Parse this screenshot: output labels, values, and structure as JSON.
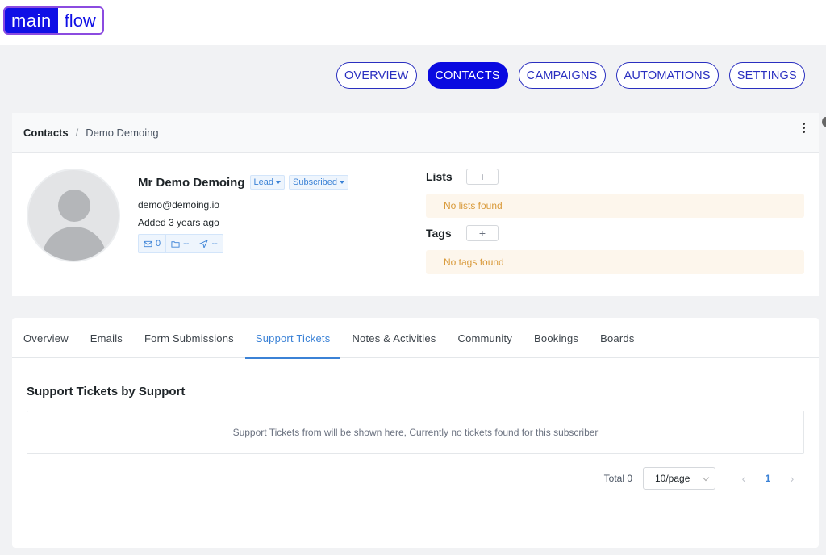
{
  "brand": {
    "part1": "main",
    "part2": "flow"
  },
  "nav": [
    {
      "label": "OVERVIEW",
      "active": false
    },
    {
      "label": "CONTACTS",
      "active": true
    },
    {
      "label": "CAMPAIGNS",
      "active": false
    },
    {
      "label": "AUTOMATIONS",
      "active": false
    },
    {
      "label": "SETTINGS",
      "active": false
    }
  ],
  "breadcrumb": {
    "root": "Contacts",
    "separator": "/",
    "current": "Demo Demoing"
  },
  "profile": {
    "name": "Mr Demo Demoing",
    "status": "Lead",
    "subscription": "Subscribed",
    "email": "demo@demoing.io",
    "added": "Added 3 years ago",
    "stats": {
      "emails": "0",
      "folders": "--",
      "sent": "--"
    }
  },
  "lists": {
    "label": "Lists",
    "add": "+",
    "empty": "No lists found"
  },
  "tags": {
    "label": "Tags",
    "add": "+",
    "empty": "No tags found"
  },
  "tabs": [
    {
      "label": "Overview",
      "active": false
    },
    {
      "label": "Emails",
      "active": false
    },
    {
      "label": "Form Submissions",
      "active": false
    },
    {
      "label": "Support Tickets",
      "active": true
    },
    {
      "label": "Notes & Activities",
      "active": false
    },
    {
      "label": "Community",
      "active": false
    },
    {
      "label": "Bookings",
      "active": false
    },
    {
      "label": "Boards",
      "active": false
    }
  ],
  "support": {
    "title": "Support Tickets by Support",
    "empty": "Support Tickets from will be shown here, Currently no tickets found for this subscriber"
  },
  "pagination": {
    "total": "Total 0",
    "page_size": "10/page",
    "prev": "‹",
    "current": "1",
    "next": "›"
  },
  "colors": {
    "brand": "#1010e6",
    "accent": "#3b82d6",
    "warning_bg": "#fdf6ec",
    "warning_text": "#d99a3a"
  }
}
